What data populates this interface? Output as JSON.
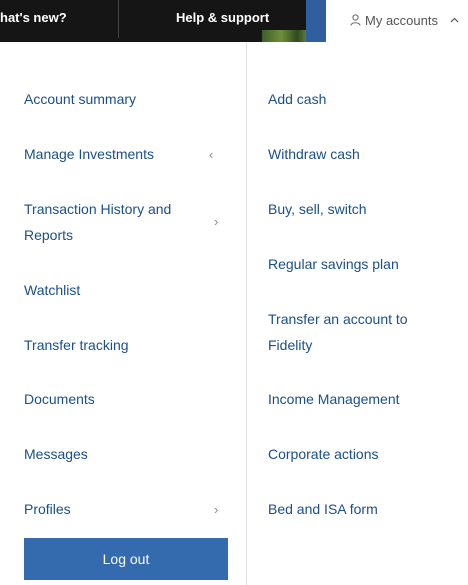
{
  "topnav": {
    "items": [
      "hat's new?",
      "Help & support"
    ],
    "accounts_label": "My accounts"
  },
  "menu": {
    "left": [
      {
        "label": "Account summary"
      },
      {
        "label": "Manage Investments",
        "chevron": "‹"
      },
      {
        "label": "Transaction History and Reports",
        "chevron": "›"
      },
      {
        "label": "Watchlist"
      },
      {
        "label": "Transfer tracking"
      },
      {
        "label": "Documents"
      },
      {
        "label": "Messages"
      },
      {
        "label": "Profiles",
        "chevron": "›"
      }
    ],
    "right": [
      {
        "label": "Add cash"
      },
      {
        "label": "Withdraw cash"
      },
      {
        "label": "Buy, sell, switch"
      },
      {
        "label": "Regular savings plan"
      },
      {
        "label": "Transfer an account to Fidelity"
      },
      {
        "label": "Income Management"
      },
      {
        "label": "Corporate actions"
      },
      {
        "label": "Bed and ISA form"
      }
    ]
  },
  "logout_label": "Log out",
  "icons": {
    "account": "user-icon",
    "accounts_toggle": "chevron-up-icon"
  },
  "colors": {
    "link": "#1a4f8b",
    "button": "#346aae",
    "topbar": "#151515",
    "accent_strip": "#2f5f9e"
  }
}
